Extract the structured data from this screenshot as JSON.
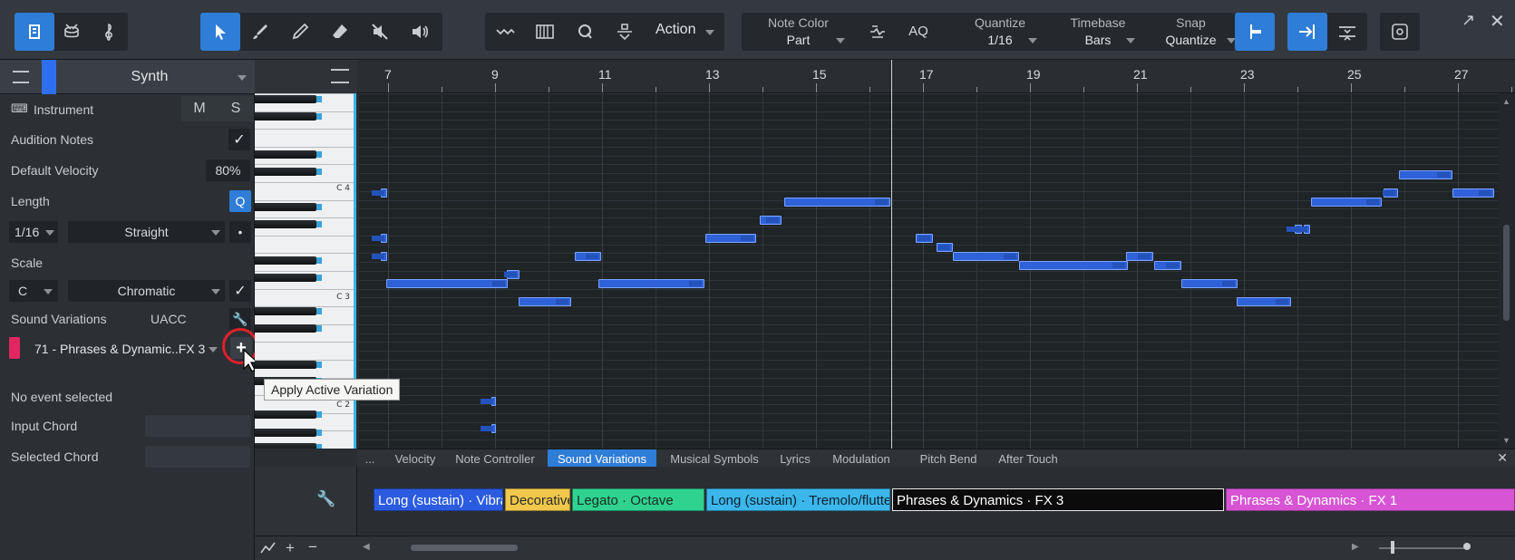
{
  "toolbar": {
    "action_label": "Action",
    "note_color": {
      "label": "Note Color",
      "value": "Part"
    },
    "aq_label": "AQ",
    "quantize": {
      "label": "Quantize",
      "value": "1/16"
    },
    "timebase": {
      "label": "Timebase",
      "value": "Bars"
    },
    "snap": {
      "label": "Snap",
      "value": "Quantize"
    }
  },
  "inspector": {
    "track_name": "Synth",
    "instrument_label": "Instrument",
    "mute": "M",
    "solo": "S",
    "audition_notes": "Audition Notes",
    "default_velocity_label": "Default Velocity",
    "default_velocity_value": "80%",
    "length_label": "Length",
    "length_q": "Q",
    "length_value": "1/16",
    "length_mode": "Straight",
    "dot": "•",
    "scale_label": "Scale",
    "scale_root": "C",
    "scale_type": "Chromatic",
    "sound_variations_label": "Sound Variations",
    "sound_variations_set": "UACC",
    "active_variation": "71 - Phrases & Dynamic..FX 3",
    "no_event": "No event selected",
    "input_chord_label": "Input Chord",
    "selected_chord_label": "Selected Chord"
  },
  "tooltip": "Apply Active Variation",
  "ruler": {
    "bars": [
      "7",
      "9",
      "11",
      "13",
      "15",
      "17",
      "19",
      "21",
      "23",
      "25",
      "27"
    ]
  },
  "keys": {
    "labels": [
      "C 4",
      "C 3",
      "C 2"
    ]
  },
  "tabs": [
    "...",
    "Velocity",
    "Note Controller",
    "Sound Variations",
    "Musical Symbols",
    "Lyrics",
    "Modulation",
    "Pitch Bend",
    "After Touch"
  ],
  "variations": [
    {
      "label": "Long (sustain) · Vibrato",
      "color": "#2b5be0",
      "text": "#ffffff"
    },
    {
      "label": "Decorative",
      "color": "#f1c84b",
      "text": "#2a2a2a"
    },
    {
      "label": "Legato · Octave",
      "color": "#2fd38f",
      "text": "#1c2a22"
    },
    {
      "label": "Long (sustain) · Tremolo/flutter",
      "color": "#3bb7ec",
      "text": "#10202a"
    },
    {
      "label": "Phrases & Dynamics · FX 3",
      "color": "#0b0b0b",
      "text": "#ffffff"
    },
    {
      "label": "Phrases & Dynamics · FX 1",
      "color": "#d754d4",
      "text": "#ffffff"
    }
  ],
  "colors": {
    "accent": "#2e7dd7",
    "note": "#2f62d8",
    "highlight_circle": "#e0202a"
  }
}
